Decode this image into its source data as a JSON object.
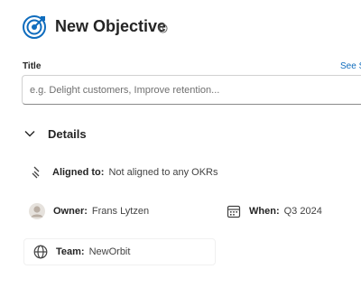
{
  "header": {
    "title": "New Objective"
  },
  "title_field": {
    "label": "Title",
    "placeholder": "e.g. Delight customers, Improve retention...",
    "value": "",
    "suggest_link": "See S"
  },
  "details": {
    "label": "Details",
    "aligned": {
      "label": "Aligned to:",
      "value": "Not aligned to any OKRs"
    },
    "owner": {
      "label": "Owner:",
      "value": "Frans Lytzen"
    },
    "when": {
      "label": "When:",
      "value": "Q3 2024"
    },
    "team": {
      "label": "Team:",
      "value": "NewOrbit"
    }
  },
  "colors": {
    "accent": "#0f6cbd",
    "text": "#242424"
  }
}
